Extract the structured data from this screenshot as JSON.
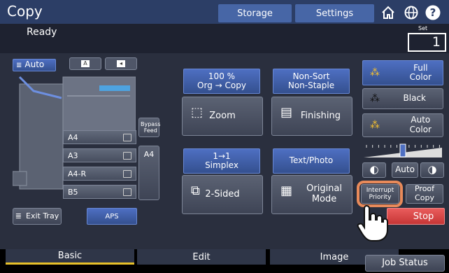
{
  "app": {
    "title": "Copy"
  },
  "header": {
    "storage_label": "Storage",
    "settings_label": "Settings",
    "home_icon": "home-icon",
    "globe_icon": "globe-icon",
    "help_icon": "help-icon"
  },
  "status": {
    "text": "Ready",
    "set_label": "Set",
    "set_value": "1"
  },
  "source": {
    "auto_label": "Auto"
  },
  "trays": [
    {
      "label": "A4"
    },
    {
      "label": "A3"
    },
    {
      "label": "A4-R"
    },
    {
      "label": "B5"
    }
  ],
  "bypass": {
    "label": "Bypass Feed",
    "paper": "A4"
  },
  "exit_tray": {
    "label": "Exit Tray"
  },
  "aps": {
    "label": "APS"
  },
  "zoom": {
    "value_line1": "100 %",
    "value_line2": "Org  →  Copy",
    "label": "Zoom"
  },
  "finishing": {
    "value_line1": "Non-Sort",
    "value_line2": "Non-Staple",
    "label": "Finishing"
  },
  "sided": {
    "value_line1": "1→1",
    "value_line2": "Simplex",
    "label": "2-Sided"
  },
  "original": {
    "value": "Text/Photo",
    "label_line1": "Original",
    "label_line2": "Mode"
  },
  "color": {
    "full_line1": "Full",
    "full_line2": "Color",
    "black": "Black",
    "auto_line1": "Auto",
    "auto_line2": "Color"
  },
  "density": {
    "auto_label": "Auto",
    "level": 0.5
  },
  "interrupt": {
    "line1": "Interrupt",
    "line2": "Priority"
  },
  "proof": {
    "line1": "Proof",
    "line2": "Copy"
  },
  "stop": {
    "label": "Stop"
  },
  "tabs": [
    {
      "label": "Basic"
    },
    {
      "label": "Edit"
    },
    {
      "label": "Image"
    }
  ],
  "job_status": {
    "label": "Job Status"
  },
  "colors": {
    "header": "#2c3e66",
    "accent_blue": "#4e6fc2",
    "stop_red": "#d94444",
    "highlight_orange": "#e88a5a",
    "tab_active_line": "#e7c12a"
  }
}
